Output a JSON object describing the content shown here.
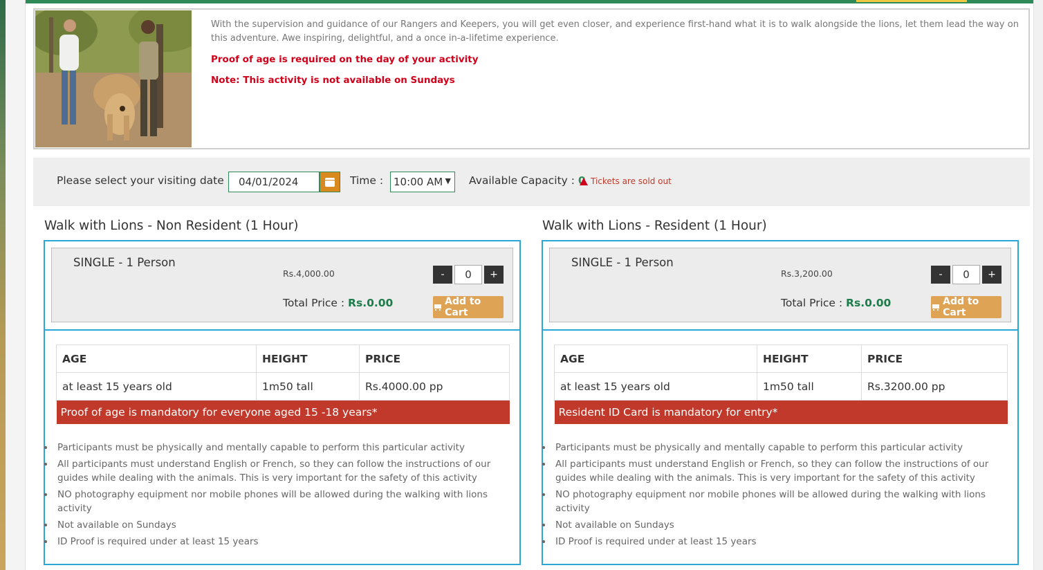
{
  "intro": {
    "description": "With the supervision and guidance of our Rangers and Keepers, you will get even closer, and experience first-hand what it is to walk alongside the lions, let them lead the way on this adventure. Awe inspiring, delightful, and a once in-a-lifetime experience.",
    "note_age": "Proof of age is required on the day of your activity",
    "note_sunday": "Note: This activity is not available on Sundays"
  },
  "booking": {
    "date_label": "Please select your visiting date :",
    "date_value": "04/01/2024",
    "time_label": "Time :",
    "time_value": "10:00 AM",
    "capacity_label": "Available Capacity :",
    "capacity_value": "0",
    "sold_out_text": "Tickets are sold out"
  },
  "products": [
    {
      "title": "Walk with Lions - Non Resident (1 Hour)",
      "ticket_name": "SINGLE - 1 Person",
      "unit_price": "Rs.4,000.00",
      "total_label": "Total Price :",
      "total_value": "Rs.0.00",
      "qty_minus": "-",
      "qty_value": "0",
      "qty_plus": "+",
      "cart_label": "Add to Cart",
      "table_headers": [
        "AGE",
        "HEIGHT",
        "PRICE"
      ],
      "table_row": [
        "at least 15 years old",
        "1m50 tall",
        "Rs.4000.00 pp"
      ],
      "banner": "Proof of age is mandatory for everyone aged 15 -18 years*",
      "rules": [
        "Participants must be physically and mentally capable to perform this particular activity",
        "All participants must understand English or French, so they can follow the instructions of our guides while dealing with the animals. This is very important for the safety of this activity",
        "NO photography equipment nor mobile phones will be allowed during the walking with lions activity",
        "Not available on Sundays",
        "ID Proof is required under at least 15 years"
      ]
    },
    {
      "title": "Walk with Lions - Resident (1 Hour)",
      "ticket_name": "SINGLE - 1 Person",
      "unit_price": "Rs.3,200.00",
      "total_label": "Total Price :",
      "total_value": "Rs.0.00",
      "qty_minus": "-",
      "qty_value": "0",
      "qty_plus": "+",
      "cart_label": "Add to Cart",
      "table_headers": [
        "AGE",
        "HEIGHT",
        "PRICE"
      ],
      "table_row": [
        "at least 15 years old",
        "1m50 tall",
        "Rs.3200.00 pp"
      ],
      "banner": "Resident ID Card is mandatory for entry*",
      "rules": [
        "Participants must be physically and mentally capable to perform this particular activity",
        "All participants must understand English or French, so they can follow the instructions of our guides while dealing with the animals. This is very important for the safety of this activity",
        "NO photography equipment nor mobile phones will be allowed during the walking with lions activity",
        "Not available on Sundays",
        "ID Proof is required under at least 15 years"
      ]
    }
  ],
  "colors": {
    "accent_green": "#2e8b57",
    "alert_red": "#c0392b",
    "cart_orange": "#dfa356",
    "box_blue": "#29a8d8"
  }
}
